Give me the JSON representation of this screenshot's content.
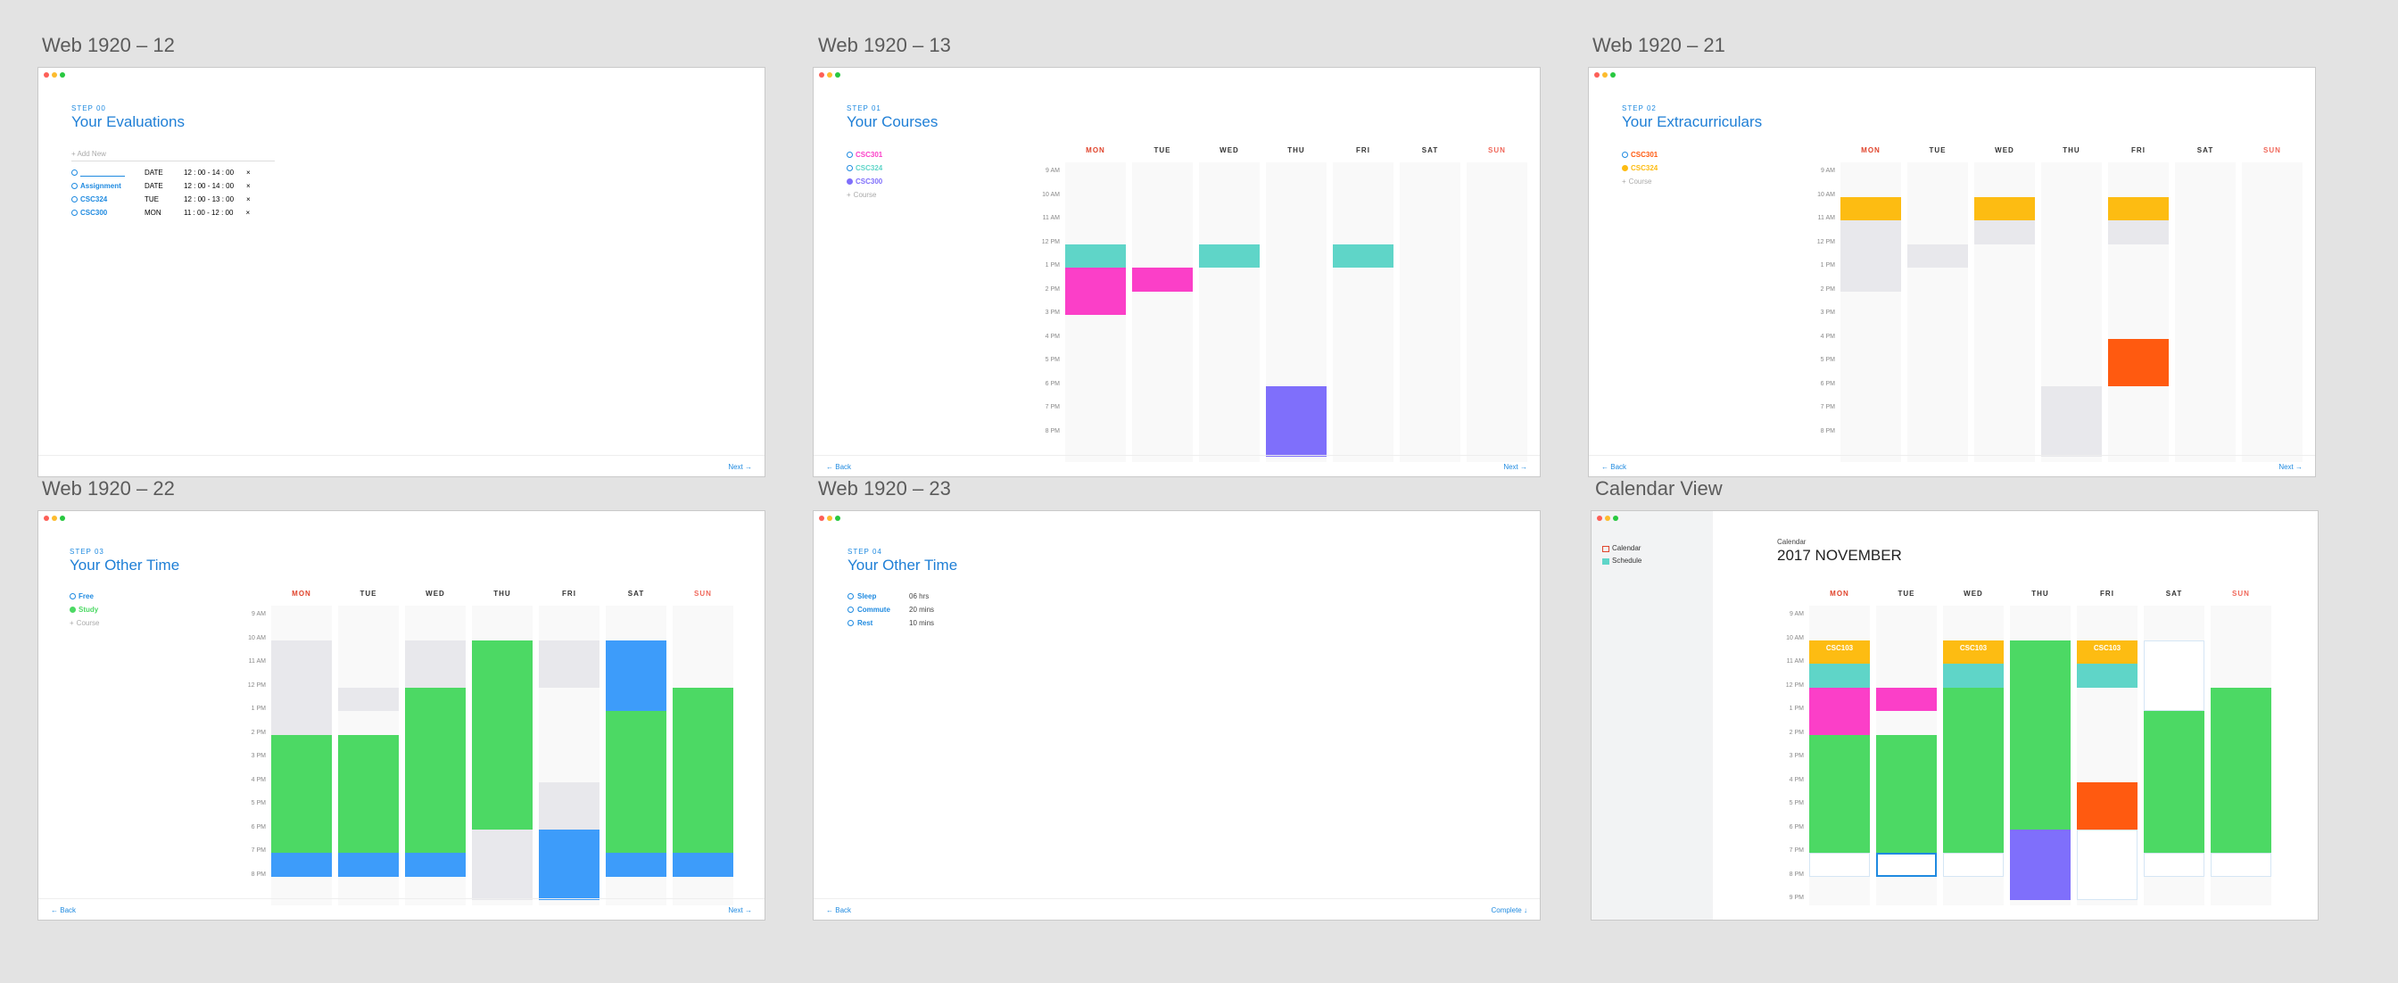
{
  "frames": {
    "f12": {
      "label": "Web 1920 – 12",
      "step": "STEP 00",
      "title": "Your Evaluations",
      "add_new": "+ Add New",
      "next": "Next"
    },
    "f13": {
      "label": "Web 1920 – 13",
      "step": "STEP 01",
      "title": "Your Courses",
      "back": "Back",
      "next": "Next"
    },
    "f21": {
      "label": "Web 1920 – 21",
      "step": "STEP 02",
      "title": "Your Extracurriculars",
      "back": "Back",
      "next": "Next"
    },
    "f22": {
      "label": "Web 1920 – 22",
      "step": "STEP 03",
      "title": "Your Other Time",
      "back": "Back",
      "next": "Next"
    },
    "f23": {
      "label": "Web 1920 – 23",
      "step": "STEP 04",
      "title": "Your Other Time",
      "back": "Back",
      "complete": "Complete"
    },
    "cal": {
      "label": "Calendar View",
      "nav_calendar": "Calendar",
      "nav_schedule": "Schedule",
      "small_title": "Calendar",
      "month": "2017 NOVEMBER"
    }
  },
  "days": [
    "MON",
    "TUE",
    "WED",
    "THU",
    "FRI",
    "SAT",
    "SUN"
  ],
  "times": [
    "9 AM",
    "10 AM",
    "11 AM",
    "12 PM",
    "1 PM",
    "2 PM",
    "3 PM",
    "4 PM",
    "5 PM",
    "6 PM",
    "7 PM",
    "8 PM",
    "9 PM"
  ],
  "colors": {
    "accent": "#1f8ae0",
    "sunday": "#f0685b",
    "monday": "#e0442c",
    "csc_cyan": "#5fd5c8",
    "csc_pink": "#fb3fc8",
    "csc_purple": "#7f6ffb",
    "extra_yellow": "#fdbc12",
    "extra_orange": "#ff5a10",
    "free_gray": "#e8e8ec",
    "study_green": "#4cd964",
    "blue": "#3d9cfa"
  },
  "evaluations": [
    {
      "name": "",
      "date": "DATE",
      "time": "12 : 00 - 14 : 00"
    },
    {
      "name": "Assignment",
      "date": "DATE",
      "time": "12 : 00 - 14 : 00"
    },
    {
      "name": "CSC324",
      "date": "TUE",
      "time": "12 : 00 - 13 : 00"
    },
    {
      "name": "CSC300",
      "date": "MON",
      "time": "11 : 00 - 12 : 00"
    }
  ],
  "courses": [
    "CSC301",
    "CSC324",
    "CSC300",
    "Course"
  ],
  "extracurriculars": [
    "CSC301",
    "CSC324",
    "Course"
  ],
  "other_time": [
    "Free",
    "Study",
    "Course"
  ],
  "other_time2": [
    {
      "name": "Sleep",
      "value": "06 hrs"
    },
    {
      "name": "Commute",
      "value": "20 mins"
    },
    {
      "name": "Rest",
      "value": "10 mins"
    }
  ],
  "cal_labels": {
    "csc": "CSC103"
  }
}
